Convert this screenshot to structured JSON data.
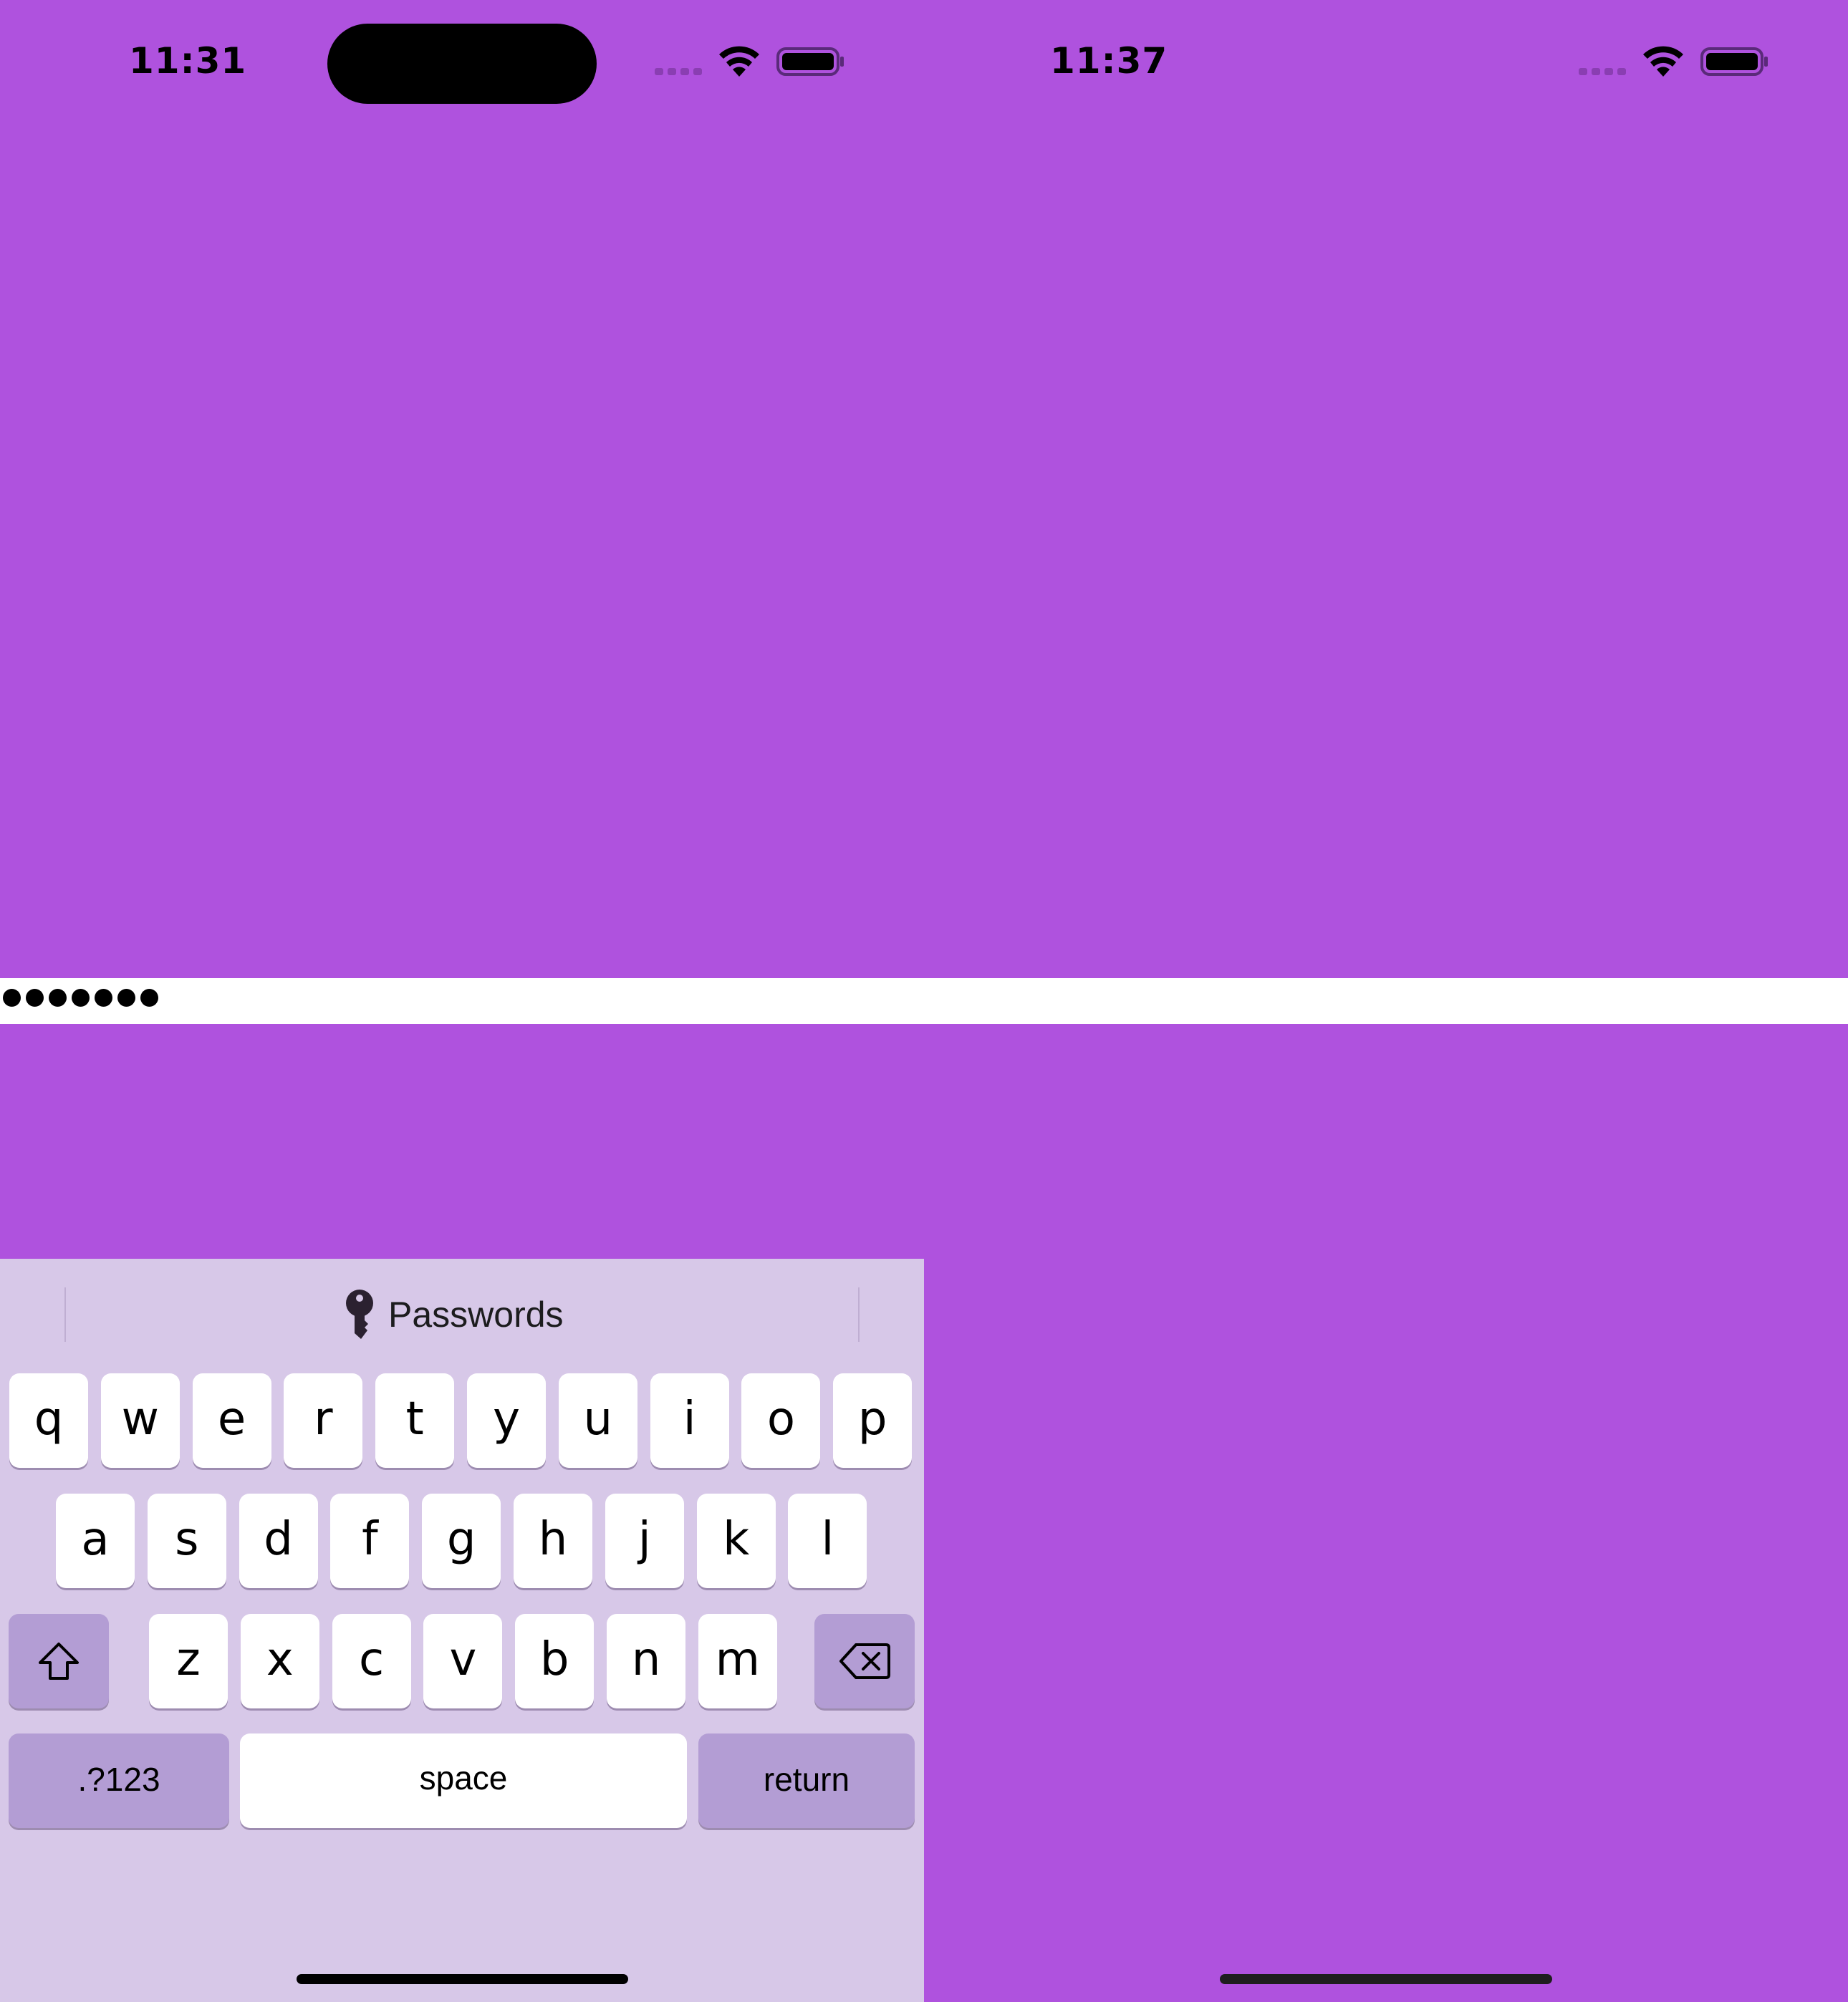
{
  "status_bar_left": {
    "time": "11:31"
  },
  "status_bar_right": {
    "time": "11:37"
  },
  "password_field": {
    "masked_length": 7
  },
  "keyboard": {
    "suggestion": {
      "label": "Passwords",
      "icon": "key-icon"
    },
    "row1": [
      "q",
      "w",
      "e",
      "r",
      "t",
      "y",
      "u",
      "i",
      "o",
      "p"
    ],
    "row2": [
      "a",
      "s",
      "d",
      "f",
      "g",
      "h",
      "j",
      "k",
      "l"
    ],
    "row3": [
      "z",
      "x",
      "c",
      "v",
      "b",
      "n",
      "m"
    ],
    "shift_icon": "shift-icon",
    "delete_icon": "delete-backward-icon",
    "numbers_label": ".?123",
    "space_label": "space",
    "return_label": "return"
  },
  "colors": {
    "background": "#AF52DE",
    "keyboard_bg": "#D7C8E8",
    "special_key": "#B39DD4",
    "key": "#FFFFFF"
  }
}
